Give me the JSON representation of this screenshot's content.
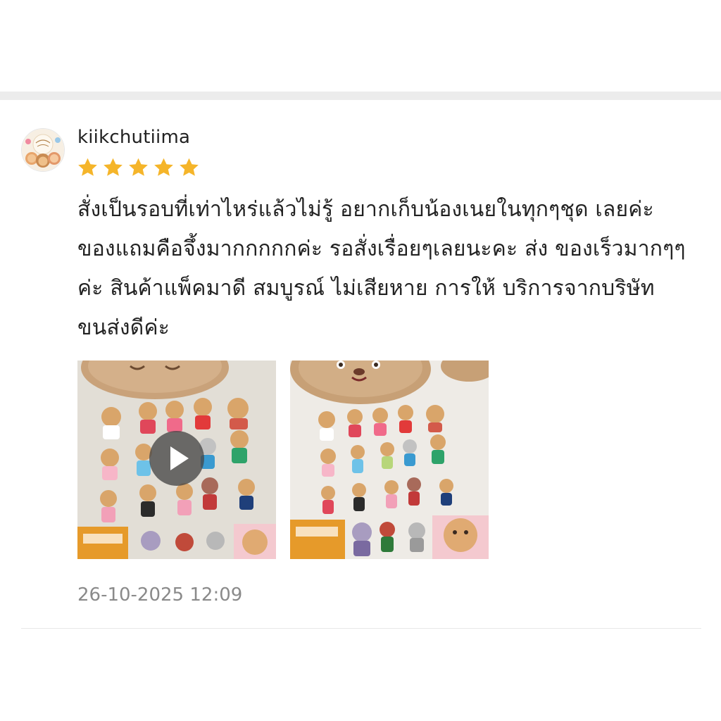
{
  "review": {
    "username": "kiikchutiima",
    "rating": 5,
    "rating_max": 5,
    "comment": "สั่งเป็นรอบที่เท่าไหร่แล้วไม่รู้ อยากเก็บน้องเนยในทุกๆชุด เลยค่ะ ของแถมคือจึ้งมากกกกกค่ะ รอสั่งเรื่อยๆเลยนะคะ ส่ง ของเร็วมากๆๆค่ะ สินค้าแพ็คมาดี สมบูรณ์ ไม่เสียหาย การให้ บริการจากบริษัทขนส่งดีค่ะ",
    "timestamp": "26-10-2025 12:09",
    "media": [
      {
        "kind": "video",
        "icon": "play-icon"
      },
      {
        "kind": "photo"
      }
    ]
  },
  "colors": {
    "star": "#f5b52a",
    "separator": "#ececec",
    "timestamp": "#8a8a8a",
    "text": "#222222"
  }
}
